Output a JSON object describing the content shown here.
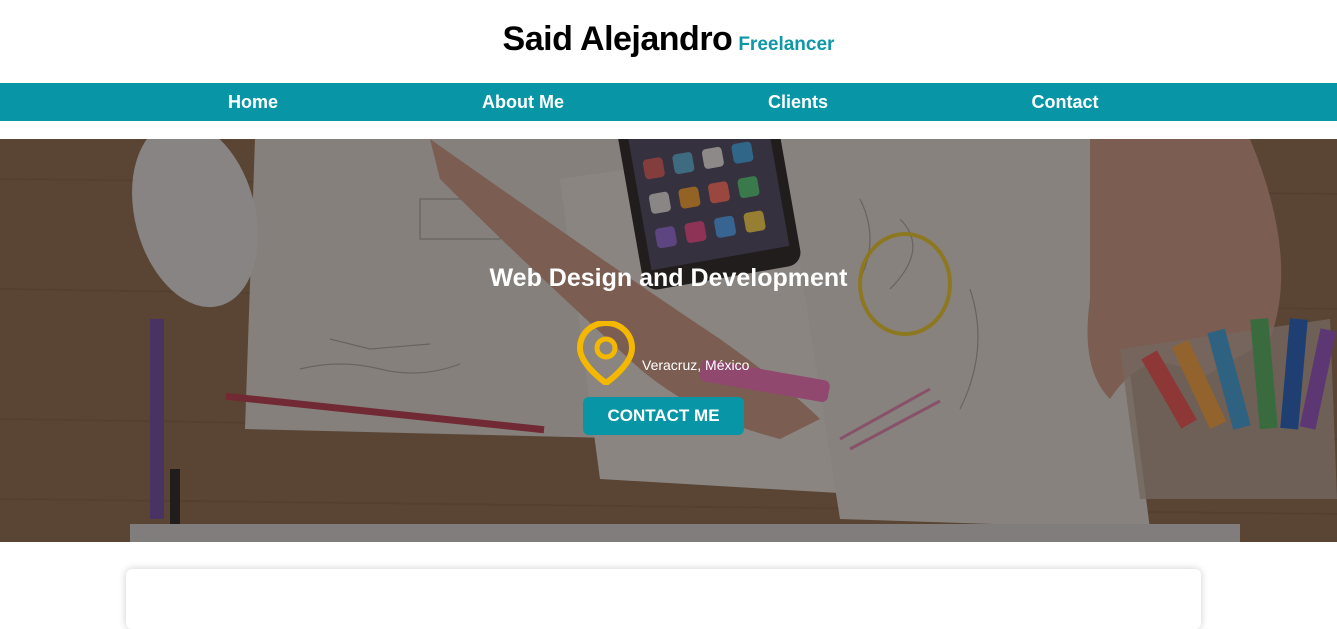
{
  "header": {
    "name": "Said Alejandro",
    "tagline": "Freelancer"
  },
  "nav": {
    "items": [
      {
        "label": "Home"
      },
      {
        "label": "About Me"
      },
      {
        "label": "Clients"
      },
      {
        "label": "Contact"
      }
    ]
  },
  "hero": {
    "title": "Web Design and Development",
    "location": "Veracruz, México",
    "cta_label": "CONTACT ME"
  },
  "colors": {
    "accent": "#0896a6",
    "pin": "#f5b800",
    "brand_tag": "#0e97a8"
  },
  "icons": {
    "location": "map-pin-icon"
  }
}
